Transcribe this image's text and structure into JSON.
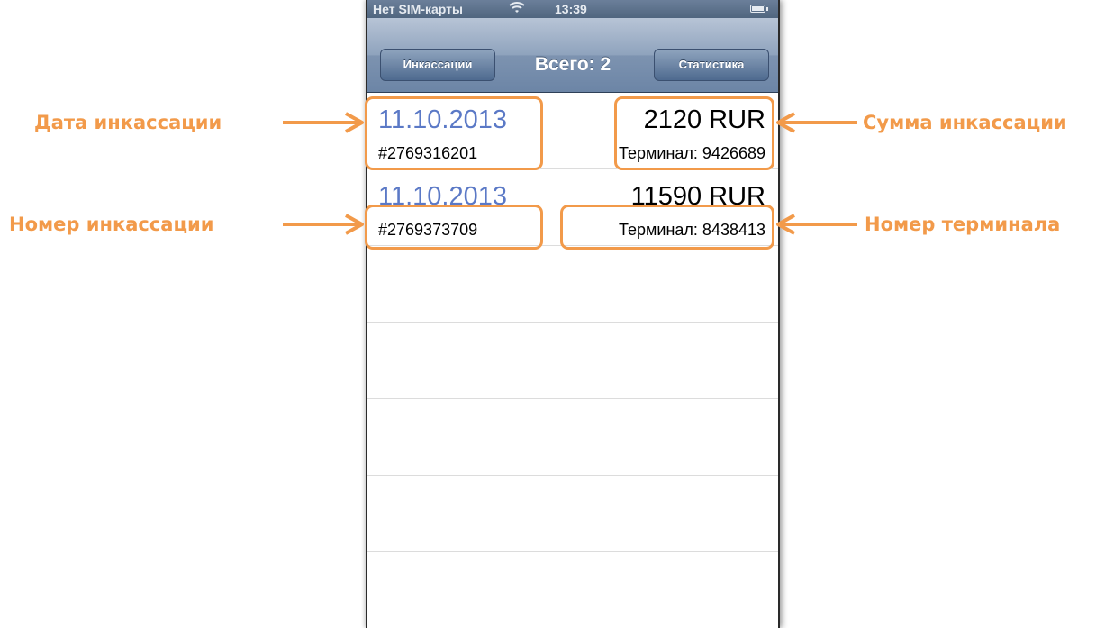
{
  "statusbar": {
    "carrier": "Нет SIM-карты",
    "time": "13:39"
  },
  "navbar": {
    "back_label": "Инкассации",
    "title": "Всего: 2",
    "right_label": "Статистика"
  },
  "rows": [
    {
      "date": "11.10.2013",
      "amount": "2120 RUR",
      "number": "#2769316201",
      "terminal": "Терминал: 9426689"
    },
    {
      "date": "11.10.2013",
      "amount": "11590 RUR",
      "number": "#2769373709",
      "terminal": "Терминал: 8438413"
    }
  ],
  "annotations": {
    "date_label": "Дата инкассации",
    "amount_label": "Сумма инкассации",
    "number_label": "Номер инкассации",
    "terminal_label": "Номер терминала",
    "color": "#f29a4a"
  }
}
